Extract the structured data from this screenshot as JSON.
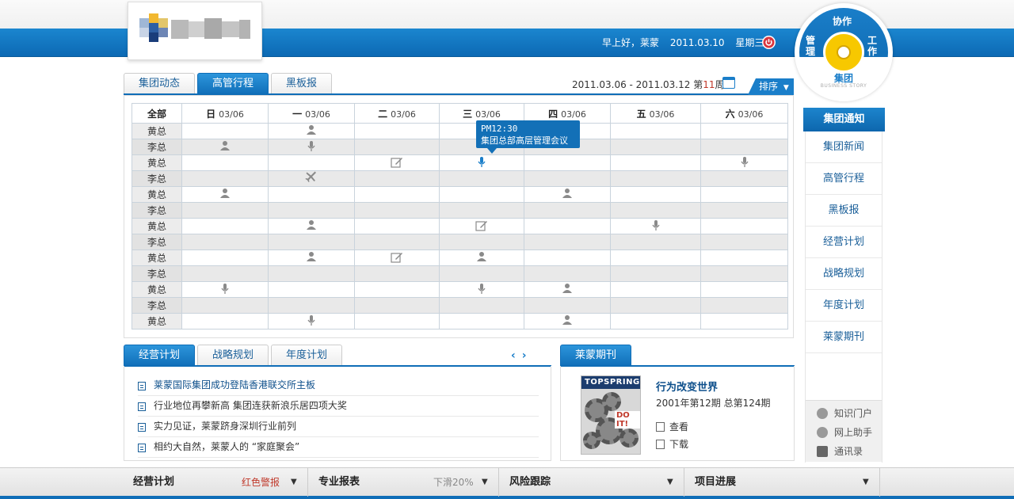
{
  "header": {
    "greeting": "早上好，莱蒙",
    "date": "2011.03.10",
    "weekday": "星期三",
    "logout_icon": "power-icon"
  },
  "badge": {
    "top": "协作",
    "left": "管理",
    "right": "工作",
    "title": "集团",
    "subtitle": "BUSINESS STORY"
  },
  "schedule": {
    "tabs": [
      "集团动态",
      "高管行程",
      "黑板报"
    ],
    "active_tab": 1,
    "range_text": "2011.03.06 - 2011.03.12",
    "week_prefix": "第",
    "week_num": "11",
    "week_suffix": "周",
    "sort_label": "排序",
    "header_all": "全部",
    "days": [
      {
        "day": "日",
        "date": "03/06"
      },
      {
        "day": "一",
        "date": "03/06"
      },
      {
        "day": "二",
        "date": "03/06"
      },
      {
        "day": "三",
        "date": "03/06"
      },
      {
        "day": "四",
        "date": "03/06"
      },
      {
        "day": "五",
        "date": "03/06"
      },
      {
        "day": "六",
        "date": "03/06"
      }
    ],
    "rows": [
      {
        "name": "黄总",
        "cells": [
          "",
          "person",
          "",
          "",
          "",
          "",
          ""
        ]
      },
      {
        "name": "李总",
        "cells": [
          "person",
          "mic",
          "",
          "",
          "",
          "",
          ""
        ]
      },
      {
        "name": "黄总",
        "cells": [
          "",
          "",
          "edit",
          "mic-active",
          "",
          "",
          "mic"
        ]
      },
      {
        "name": "李总",
        "cells": [
          "",
          "plane",
          "",
          "",
          "",
          "",
          ""
        ]
      },
      {
        "name": "黄总",
        "cells": [
          "person",
          "",
          "",
          "",
          "person",
          "",
          ""
        ]
      },
      {
        "name": "李总",
        "cells": [
          "",
          "",
          "",
          "",
          "",
          "",
          ""
        ]
      },
      {
        "name": "黄总",
        "cells": [
          "",
          "person",
          "",
          "edit",
          "",
          "mic",
          ""
        ]
      },
      {
        "name": "李总",
        "cells": [
          "",
          "",
          "",
          "",
          "",
          "",
          ""
        ]
      },
      {
        "name": "黄总",
        "cells": [
          "",
          "person",
          "edit",
          "person",
          "",
          "",
          ""
        ]
      },
      {
        "name": "李总",
        "cells": [
          "",
          "",
          "",
          "",
          "",
          "",
          ""
        ]
      },
      {
        "name": "黄总",
        "cells": [
          "mic",
          "",
          "",
          "mic",
          "person",
          "",
          ""
        ]
      },
      {
        "name": "李总",
        "cells": [
          "",
          "",
          "",
          "",
          "",
          "",
          ""
        ]
      },
      {
        "name": "黄总",
        "cells": [
          "",
          "mic",
          "",
          "",
          "person",
          "",
          ""
        ]
      }
    ],
    "tooltip": {
      "time": "PM12:30",
      "text": "集团总部高层管理会议"
    }
  },
  "plans": {
    "tabs": [
      "经营计划",
      "战略规划",
      "年度计划"
    ],
    "active_tab": 0,
    "items": [
      "莱蒙国际集团成功登陆香港联交所主板",
      "行业地位再攀新高 集团连获新浪乐居四项大奖",
      "实力见证，莱蒙跻身深圳行业前列",
      "相约大自然，莱蒙人的 “家庭聚会”"
    ]
  },
  "magazine": {
    "tab": "莱蒙期刊",
    "cover_brand": "TOPSPRING",
    "cover_tag": "DO IT!",
    "title": "行为改变世界",
    "issue": "2001年第12期 总第124期",
    "view": "查看",
    "download": "下载"
  },
  "sidebar": {
    "items": [
      "集团通知",
      "集团新闻",
      "高管行程",
      "黑板报",
      "经营计划",
      "战略规划",
      "年度计划",
      "莱蒙期刊"
    ],
    "active": 0,
    "footer": [
      "知识门户",
      "网上助手",
      "通讯录"
    ]
  },
  "bottombar": [
    {
      "label": "经营计划",
      "status": "红色警报",
      "status_color": "#c0392b"
    },
    {
      "label": "专业报表",
      "status": "下滑20%",
      "status_color": "#888888"
    },
    {
      "label": "风险跟踪",
      "status": "",
      "status_color": "#888888"
    },
    {
      "label": "项目进展",
      "status": "",
      "status_color": "#888888"
    }
  ]
}
